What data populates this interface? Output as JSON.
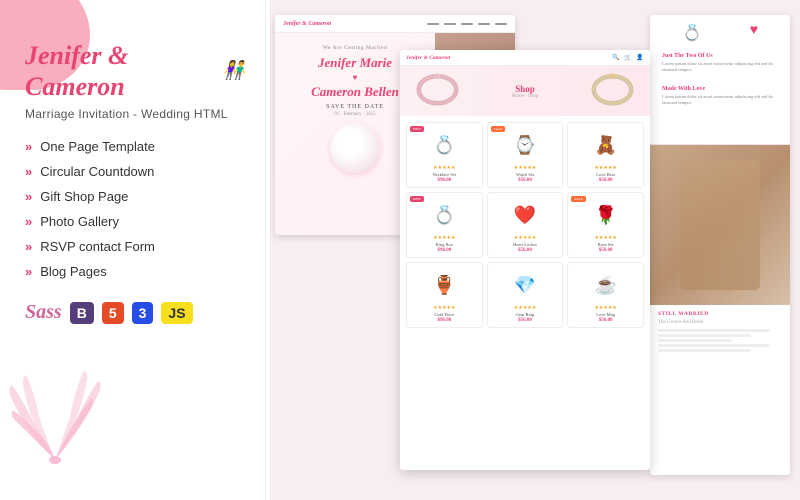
{
  "brand": {
    "name": "Jenifer & Cameron",
    "tagline": "Marriage Invitation - Wedding HTML",
    "couple_icon": "👫"
  },
  "features": [
    "One Page Template",
    "Circular Countdown",
    "Gift Shop Page",
    "Photo Gallery",
    "RSVP contact Form",
    "Blog Pages"
  ],
  "tech_badges": [
    {
      "label": "Sass",
      "type": "sass"
    },
    {
      "label": "B",
      "type": "bootstrap"
    },
    {
      "label": "5",
      "type": "html5"
    },
    {
      "label": "3",
      "type": "css3"
    },
    {
      "label": "JS",
      "type": "js"
    }
  ],
  "screenshot1": {
    "nav_brand": "Jenifer & Cameron",
    "getting_married": "We Are Getting Married",
    "name1": "Jenifer Marie",
    "name2": "Cameron Bellen",
    "save_date": "Save The Date"
  },
  "screenshot2": {
    "nav_brand": "Jenifer & Cameron",
    "shop_title": "Shop",
    "breadcrumb": "Home · Shop",
    "products": [
      {
        "emoji": "💍",
        "name": "Necklace Set",
        "price": "$96.00",
        "badge": "NEW",
        "stars": "★★★★★"
      },
      {
        "emoji": "⌚",
        "name": "Watch Set",
        "price": "$56.00",
        "badge": "SALE",
        "stars": "★★★★★"
      },
      {
        "emoji": "🧸",
        "name": "Love Bear",
        "price": "$56.00",
        "badge": "",
        "stars": "★★★★★"
      },
      {
        "emoji": "💍",
        "name": "Ring Box",
        "price": "$96.00",
        "badge": "NEW",
        "stars": "★★★★★"
      },
      {
        "emoji": "❤️",
        "name": "Heart Locket",
        "price": "$56.00",
        "badge": "",
        "stars": "★★★★★"
      },
      {
        "emoji": "🌹",
        "name": "Rose Set",
        "price": "$56.00",
        "badge": "SALE",
        "stars": "★★★★★"
      },
      {
        "emoji": "🏺",
        "name": "Gold Piece",
        "price": "$96.00",
        "badge": "",
        "stars": "★★★★★"
      },
      {
        "emoji": "💎",
        "name": "Gem Ring",
        "price": "$56.00",
        "badge": "",
        "stars": "★★★★★"
      },
      {
        "emoji": "☕",
        "name": "Love Mug",
        "price": "$56.00",
        "badge": "",
        "stars": "★★★★★"
      }
    ]
  },
  "screenshot3": {
    "title": "Just The Two Of Us",
    "subtitle": "Made With Love",
    "body_text": "Lorem ipsum dolor sit amet consectetur adipiscing elit sed do eiusmod tempor.",
    "bottom_title": "STILL MARRIED",
    "groom_bride": "The Groom And Bride"
  }
}
